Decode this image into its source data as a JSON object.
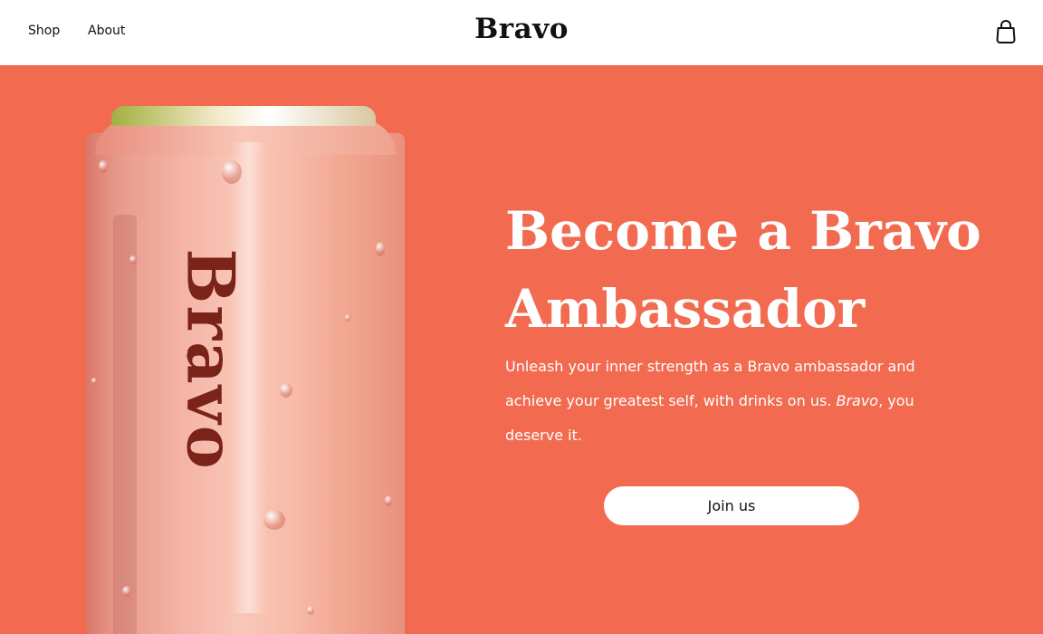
{
  "nav": {
    "shop": "Shop",
    "about": "About"
  },
  "brand": {
    "logo": "Bravo",
    "can_label": "Bravo"
  },
  "cart_icon": "shopping-bag-icon",
  "hero": {
    "headline_line1": "Become a Bravo",
    "headline_line2": "Ambassador",
    "description_part1": "Unleash your inner strength as a Bravo ambassador and achieve your greatest self, with drinks on us. ",
    "description_emphasis": "Bravo",
    "description_part2": ", you deserve it.",
    "cta_label": "Join us"
  },
  "colors": {
    "hero_background": "#f26b50",
    "header_background": "#ffffff",
    "text_light": "#ffffff",
    "text_dark": "#111111",
    "can_label": "#7a2318"
  }
}
